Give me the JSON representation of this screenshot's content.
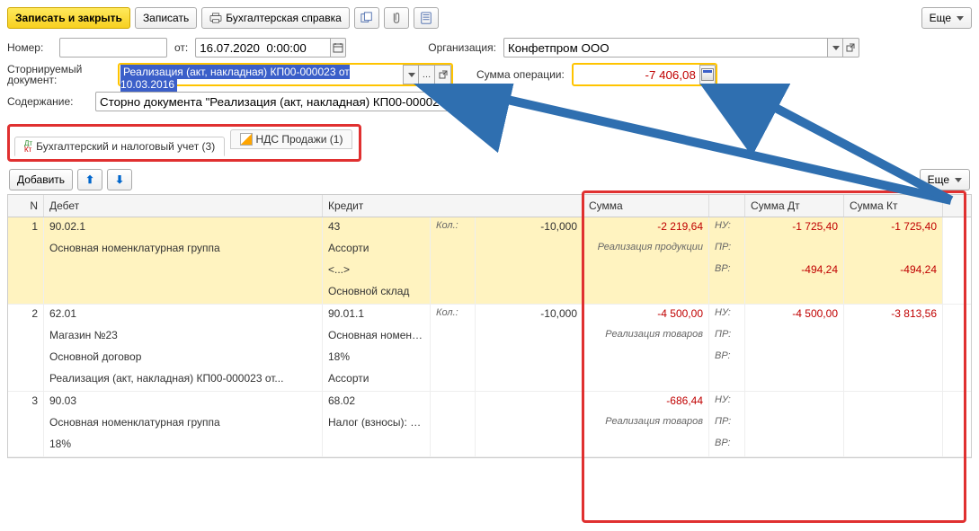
{
  "toolbar": {
    "save_close": "Записать и закрыть",
    "save": "Записать",
    "accounting_note": "Бухгалтерская справка",
    "more": "Еще"
  },
  "form": {
    "number_label": "Номер:",
    "number_value": "",
    "from_label": "от:",
    "date_value": "16.07.2020  0:00:00",
    "org_label": "Организация:",
    "org_value": "Конфетпром ООО",
    "reversing_label": "Сторнируемый документ:",
    "reversing_value": "Реализация (акт, накладная) КП00-000023 от 10.03.2016",
    "opsum_label": "Сумма операции:",
    "opsum_value": "-7 406,08",
    "content_label": "Содержание:",
    "content_value": "Сторно документа \"Реализация (акт, накладная) КП00-000023 от 10"
  },
  "tabs": {
    "accounting": "Бухгалтерский и налоговый учет (3)",
    "vat": "НДС Продажи (1)"
  },
  "tabletb": {
    "add": "Добавить",
    "more": "Еще"
  },
  "grid_headers": {
    "n": "N",
    "debit": "Дебет",
    "credit": "Кредит",
    "sum": "Сумма",
    "sum_dt": "Сумма Дт",
    "sum_kt": "Сумма Кт"
  },
  "rows": [
    {
      "n": "1",
      "debit_acc": "90.02.1",
      "debit_line1": "Основная номенклатурная группа",
      "debit_line2": "",
      "debit_line3": "",
      "credit_acc": "43",
      "credit_qty_label": "Кол.:",
      "credit_qty_val": "-10,000",
      "credit_line1": "Ассорти",
      "credit_line2": "<...>",
      "credit_line3": "Основной склад",
      "sum": "-2 219,64",
      "sum_desc": "Реализация продукции",
      "nu_dt": "-1 725,40",
      "nu_kt": "-1 725,40",
      "pr_dt": "",
      "pr_kt": "",
      "vr_dt": "-494,24",
      "vr_kt": "-494,24",
      "highlighted": true
    },
    {
      "n": "2",
      "debit_acc": "62.01",
      "debit_line1": "Магазин №23",
      "debit_line2": "Основной договор",
      "debit_line3": "Реализация (акт, накладная) КП00-000023 от...",
      "credit_acc": "90.01.1",
      "credit_qty_label": "Кол.:",
      "credit_qty_val": "-10,000",
      "credit_line1": "Основная номенклатурная группа",
      "credit_line2": "18%",
      "credit_line3": "Ассорти",
      "sum": "-4 500,00",
      "sum_desc": "Реализация товаров",
      "nu_dt": "-4 500,00",
      "nu_kt": "-3 813,56",
      "pr_dt": "",
      "pr_kt": "",
      "vr_dt": "",
      "vr_kt": "",
      "highlighted": false
    },
    {
      "n": "3",
      "debit_acc": "90.03",
      "debit_line1": "Основная номенклатурная группа",
      "debit_line2": "18%",
      "debit_line3": "",
      "credit_acc": "68.02",
      "credit_qty_label": "",
      "credit_qty_val": "",
      "credit_line1": "Налог (взносы): начислено / уплачено",
      "credit_line2": "",
      "credit_line3": "",
      "sum": "-686,44",
      "sum_desc": "Реализация товаров",
      "nu_dt": "",
      "nu_kt": "",
      "pr_dt": "",
      "pr_kt": "",
      "vr_dt": "",
      "vr_kt": "",
      "highlighted": false
    }
  ],
  "tax_labels": {
    "nu": "НУ:",
    "pr": "ПР:",
    "vr": "ВР:"
  },
  "colors": {
    "accent_yellow": "#f7d020",
    "warn_red": "#e03030",
    "neg": "#c00000",
    "arrow_blue": "#2f6fb0"
  }
}
